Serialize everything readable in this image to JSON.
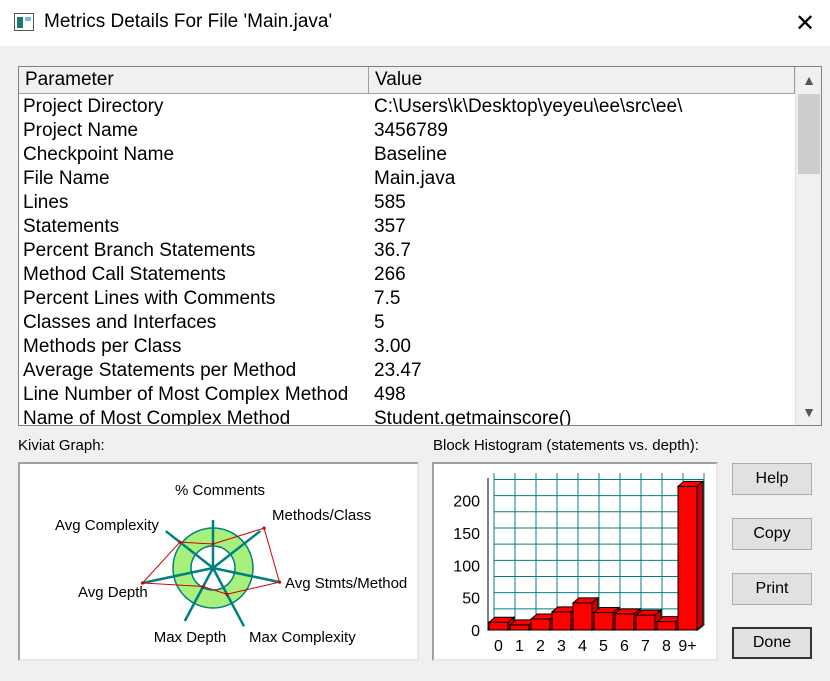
{
  "window": {
    "title": "Metrics Details For File 'Main.java'",
    "close": "✕"
  },
  "table": {
    "headers": {
      "parameter": "Parameter",
      "value": "Value"
    },
    "rows": [
      {
        "p": "Project Directory",
        "v": "C:\\Users\\k\\Desktop\\yeyeu\\ee\\src\\ee\\"
      },
      {
        "p": "Project Name",
        "v": "3456789"
      },
      {
        "p": "Checkpoint Name",
        "v": "Baseline"
      },
      {
        "p": "File Name",
        "v": "Main.java"
      },
      {
        "p": "Lines",
        "v": "585"
      },
      {
        "p": "Statements",
        "v": "357"
      },
      {
        "p": "Percent Branch Statements",
        "v": "36.7"
      },
      {
        "p": "Method Call Statements",
        "v": "266"
      },
      {
        "p": "Percent Lines with Comments",
        "v": "7.5"
      },
      {
        "p": "Classes and Interfaces",
        "v": "5"
      },
      {
        "p": "Methods per Class",
        "v": "3.00"
      },
      {
        "p": "Average Statements per Method",
        "v": "23.47"
      },
      {
        "p": "Line Number of Most Complex Method",
        "v": "498"
      },
      {
        "p": "Name of Most Complex Method",
        "v": "Student.getmainscore()"
      }
    ]
  },
  "kiviat": {
    "label": "Kiviat Graph:",
    "axes": [
      "% Comments",
      "Methods/Class",
      "Avg Stmts/Method",
      "Max Complexity",
      "Max Depth",
      "Avg Depth",
      "Avg Complexity"
    ],
    "ring_color": "#a8f07c",
    "line_color": "#008080",
    "series_color": "#cc0000"
  },
  "histogram": {
    "label": "Block Histogram (statements vs. depth):",
    "bar_color": "#ff0000",
    "grid_color": "#008080"
  },
  "chart_data": {
    "type": "bar",
    "categories": [
      "0",
      "1",
      "2",
      "3",
      "4",
      "5",
      "6",
      "7",
      "8",
      "9+"
    ],
    "values": [
      12,
      8,
      17,
      28,
      42,
      27,
      25,
      23,
      13,
      222
    ],
    "ylim": [
      0,
      235
    ],
    "yticks": [
      0,
      50,
      100,
      150,
      200
    ],
    "grid": true
  },
  "buttons": {
    "help": "Help",
    "copy": "Copy",
    "print": "Print",
    "done": "Done"
  }
}
